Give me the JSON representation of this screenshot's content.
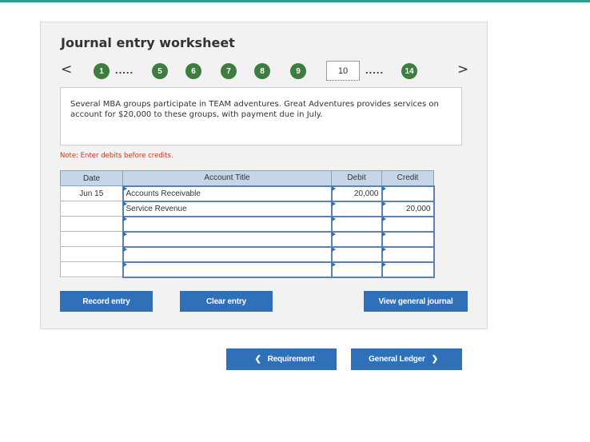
{
  "worksheet": {
    "title": "Journal entry worksheet",
    "prev_arrow": "<",
    "next_arrow": ">",
    "steps": [
      {
        "label": "1"
      },
      {
        "label": "5"
      },
      {
        "label": "6"
      },
      {
        "label": "7"
      },
      {
        "label": "8"
      },
      {
        "label": "9"
      }
    ],
    "current_step": "10",
    "last_step": "14",
    "dots": ".....",
    "description": "Several MBA groups participate in TEAM adventures. Great Adventures provides services on account for $20,000 to these groups, with payment due in July.",
    "note": "Note: Enter debits before credits."
  },
  "table": {
    "headers": {
      "date": "Date",
      "account": "Account Title",
      "debit": "Debit",
      "credit": "Credit"
    },
    "rows": [
      {
        "date": "Jun 15",
        "account": "Accounts Receivable",
        "debit": "20,000",
        "credit": ""
      },
      {
        "date": "",
        "account": "Service Revenue",
        "debit": "",
        "credit": "20,000"
      },
      {
        "date": "",
        "account": "",
        "debit": "",
        "credit": ""
      },
      {
        "date": "",
        "account": "",
        "debit": "",
        "credit": ""
      },
      {
        "date": "",
        "account": "",
        "debit": "",
        "credit": ""
      },
      {
        "date": "",
        "account": "",
        "debit": "",
        "credit": ""
      }
    ]
  },
  "buttons": {
    "record": "Record entry",
    "clear": "Clear entry",
    "view": "View general journal",
    "requirement": "Requirement",
    "general_ledger": "General Ledger"
  },
  "colors": {
    "accent": "#2f70b8",
    "step_green": "#3f7c3f",
    "header_blue": "#c6d6e8",
    "note_red": "#c0392b",
    "top_bar": "#2a9d8f"
  },
  "icons": {
    "prev": "chevron-left-icon",
    "next": "chevron-right-icon"
  }
}
